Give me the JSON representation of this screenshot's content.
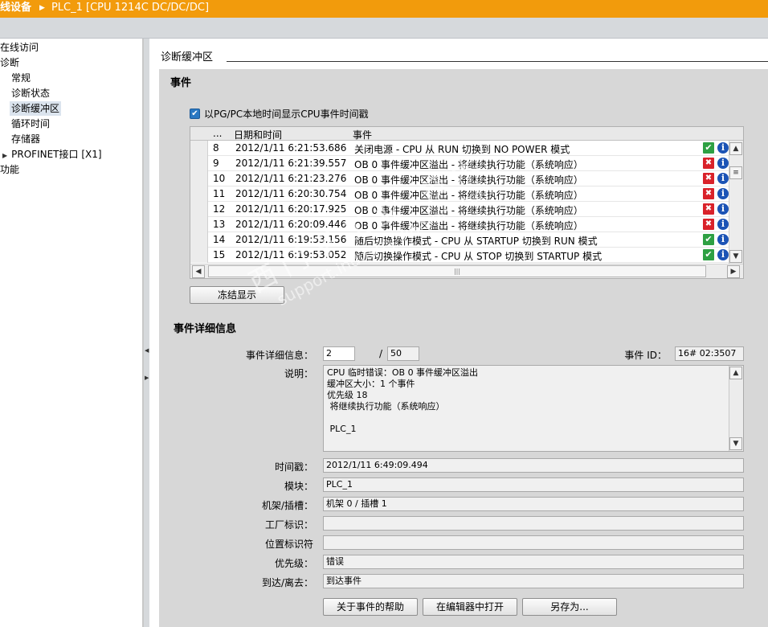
{
  "title": {
    "text": "线设备",
    "subtitle": "PLC_1 [CPU 1214C DC/DC/DC]"
  },
  "nav": {
    "items": [
      {
        "label": "在线访问",
        "indent": 0,
        "arrow": false
      },
      {
        "label": "诊断",
        "indent": 0,
        "arrow": false
      },
      {
        "label": "常规",
        "indent": 1,
        "arrow": false
      },
      {
        "label": "诊断状态",
        "indent": 1,
        "arrow": false
      },
      {
        "label": "诊断缓冲区",
        "indent": 1,
        "arrow": false,
        "selected": true
      },
      {
        "label": "循环时间",
        "indent": 1,
        "arrow": false
      },
      {
        "label": "存储器",
        "indent": 1,
        "arrow": false
      },
      {
        "label": "PROFINET接口 [X1]",
        "indent": 1,
        "arrow": true
      },
      {
        "label": "功能",
        "indent": 0,
        "arrow": false
      }
    ]
  },
  "panel": {
    "section_title": "诊断缓冲区",
    "events_heading": "事件",
    "checkbox_label": "以PG/PC本地时间显示CPU事件时间戳",
    "checkbox_checked": true,
    "columns": {
      "num": "...",
      "datetime": "日期和时间",
      "event": "事件"
    },
    "rows": [
      {
        "num": "8",
        "datetime": "2012/1/11 6:21:53.686",
        "event": "关闭电源 - CPU 从 RUN 切换到 NO POWER 模式",
        "status": "ok-icon"
      },
      {
        "num": "9",
        "datetime": "2012/1/11 6:21:39.557",
        "event": "OB 0 事件缓冲区溢出 - 将继续执行功能（系统响应）",
        "status": "error-icon"
      },
      {
        "num": "10",
        "datetime": "2012/1/11 6:21:23.276",
        "event": "OB 0 事件缓冲区溢出 - 将继续执行功能（系统响应）",
        "status": "error-icon"
      },
      {
        "num": "11",
        "datetime": "2012/1/11 6:20:30.754",
        "event": "OB 0 事件缓冲区溢出 - 将继续执行功能（系统响应）",
        "status": "error-icon"
      },
      {
        "num": "12",
        "datetime": "2012/1/11 6:20:17.925",
        "event": "OB 0 事件缓冲区溢出 - 将继续执行功能（系统响应）",
        "status": "error-icon"
      },
      {
        "num": "13",
        "datetime": "2012/1/11 6:20:09.446",
        "event": "OB 0 事件缓冲区溢出 - 将继续执行功能（系统响应）",
        "status": "error-icon"
      },
      {
        "num": "14",
        "datetime": "2012/1/11 6:19:53.156",
        "event": "随后切换操作模式 - CPU 从 STARTUP 切换到 RUN 模式",
        "status": "ok-icon"
      },
      {
        "num": "15",
        "datetime": "2012/1/11 6:19:53.052",
        "event": "随后切换操作模式 - CPU 从 STOP 切换到 STARTUP 模式",
        "status": "ok-icon"
      }
    ],
    "freeze_button": "冻结显示",
    "details_heading": "事件详细信息",
    "details": {
      "detail_label": "事件详细信息：",
      "detail_index": "2",
      "detail_sep": "/",
      "detail_total": "50",
      "event_id_label": "事件 ID：",
      "event_id": "16# 02:3507",
      "description_label": "说明：",
      "description_lines": [
        "CPU 临时错误：OB 0 事件缓冲区溢出",
        "缓冲区大小：1 个事件",
        "优先级 18",
        " 将继续执行功能（系统响应）",
        "",
        " PLC_1"
      ],
      "timestamp_label": "时间戳：",
      "timestamp": "2012/1/11 6:49:09.494",
      "module_label": "模块：",
      "module": "PLC_1",
      "rack_slot_label": "机架/插槽：",
      "rack_slot": "机架 0 / 插槽 1",
      "plant_label": "工厂标识：",
      "plant": "",
      "location_label": "位置标识符",
      "location": "",
      "priority_label": "优先级：",
      "priority": "错误",
      "coming_going_label": "到达/离去：",
      "coming_going": "到达事件"
    },
    "buttons": {
      "help": "关于事件的帮助",
      "open_editor": "在编辑器中打开",
      "save_as": "另存为..."
    }
  },
  "watermark": {
    "line1": "西门子工业 技术",
    "line2": "support.industry.siemens.com"
  }
}
